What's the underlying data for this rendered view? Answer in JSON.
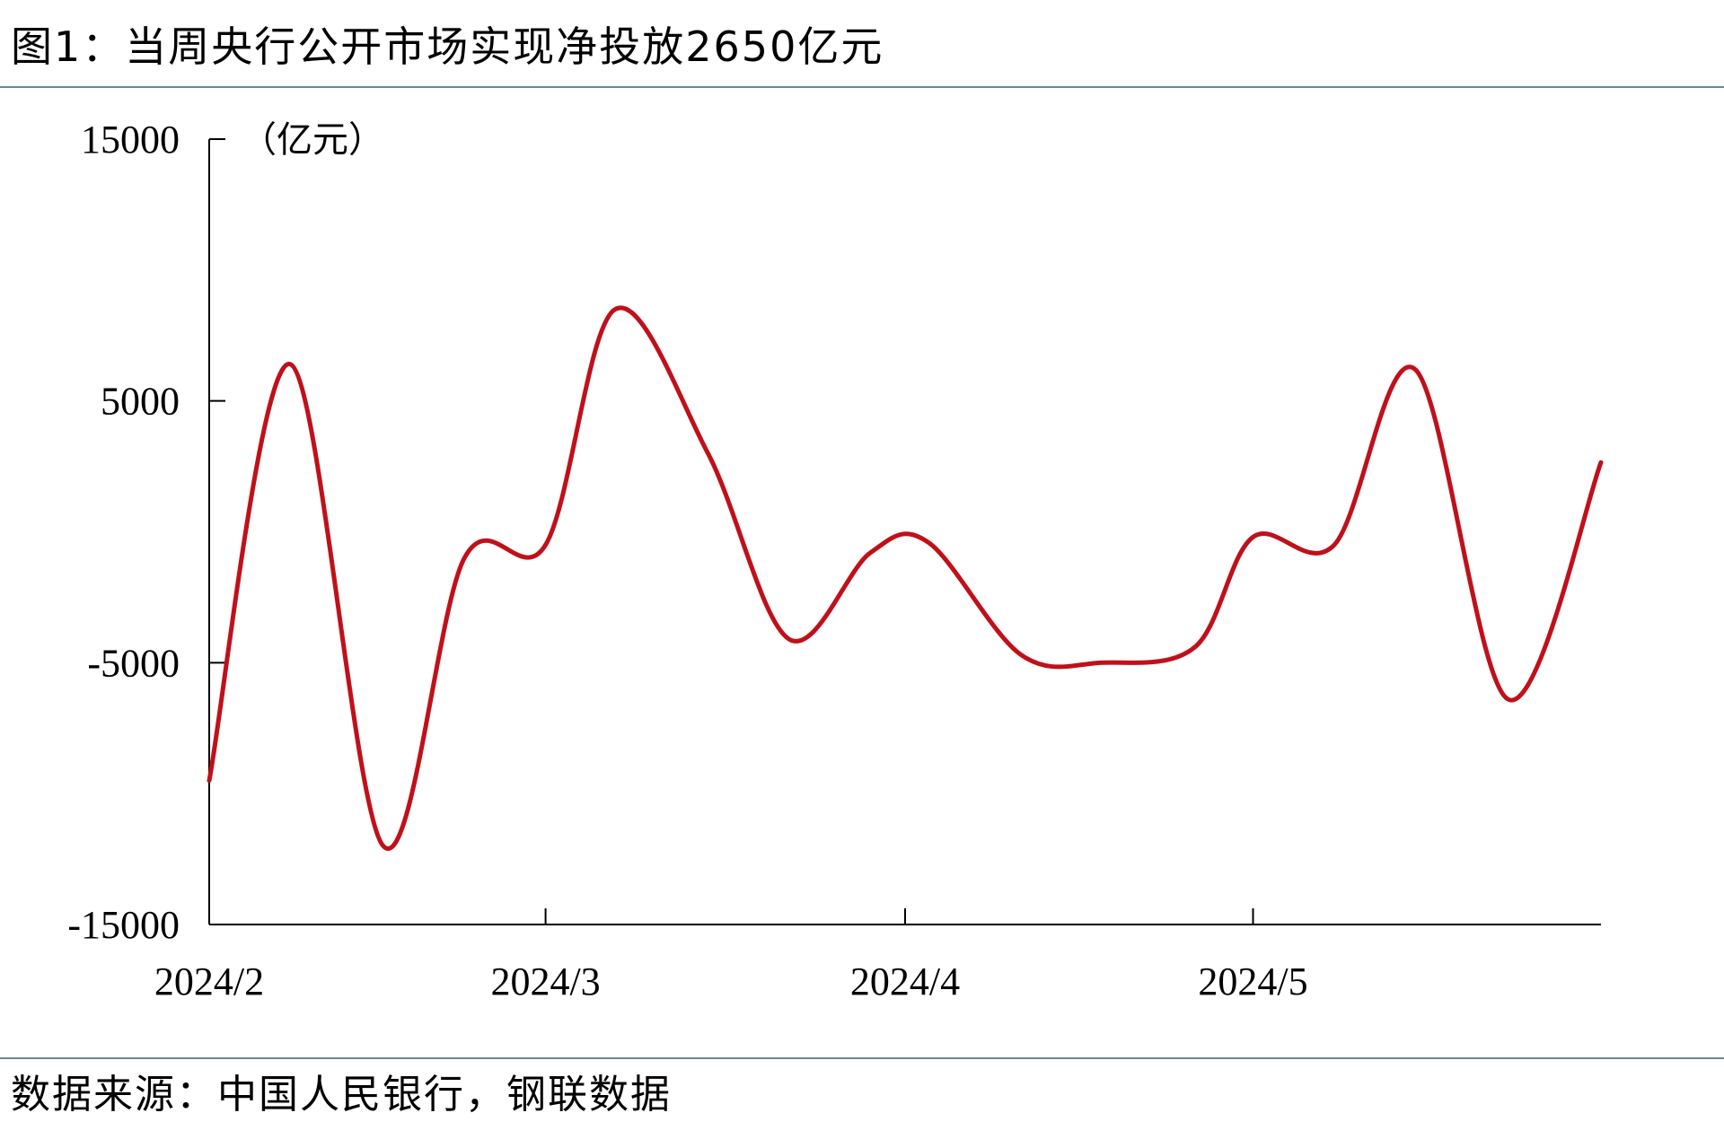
{
  "title": "图1：当周央行公开市场实现净投放2650亿元",
  "source": "数据来源：中国人民银行，钢联数据",
  "colors": {
    "series": "#c0101a",
    "rule": "#6a8a8a",
    "axis": "#000000"
  },
  "chart_data": {
    "type": "line",
    "title": "图1：当周央行公开市场实现净投放2650亿元",
    "ylabel": "（亿元）",
    "xlabel": "",
    "ylim": [
      -15000,
      15000
    ],
    "yticks": [
      15000,
      5000,
      -5000,
      -15000
    ],
    "xlim": [
      "2024-02-01",
      "2024-05-31"
    ],
    "xtick_labels": [
      "2024/2",
      "2024/3",
      "2024/4",
      "2024/5"
    ],
    "xtick_dates": [
      "2024-02-01",
      "2024-03-01",
      "2024-04-01",
      "2024-05-01"
    ],
    "grid": false,
    "legend": "none",
    "series": [
      {
        "name": "",
        "x": [
          "2024-02-01",
          "2024-02-08",
          "2024-02-16",
          "2024-02-23",
          "2024-03-01",
          "2024-03-07",
          "2024-03-15",
          "2024-03-22",
          "2024-03-29",
          "2024-04-03",
          "2024-04-11",
          "2024-04-18",
          "2024-04-26",
          "2024-05-01",
          "2024-05-08",
          "2024-05-15",
          "2024-05-23",
          "2024-05-31"
        ],
        "values": [
          -9500,
          6400,
          -12000,
          -1000,
          -500,
          8500,
          3000,
          -4100,
          -800,
          -400,
          -4700,
          -5000,
          -4400,
          -200,
          -500,
          6200,
          -6400,
          2650
        ]
      }
    ]
  }
}
